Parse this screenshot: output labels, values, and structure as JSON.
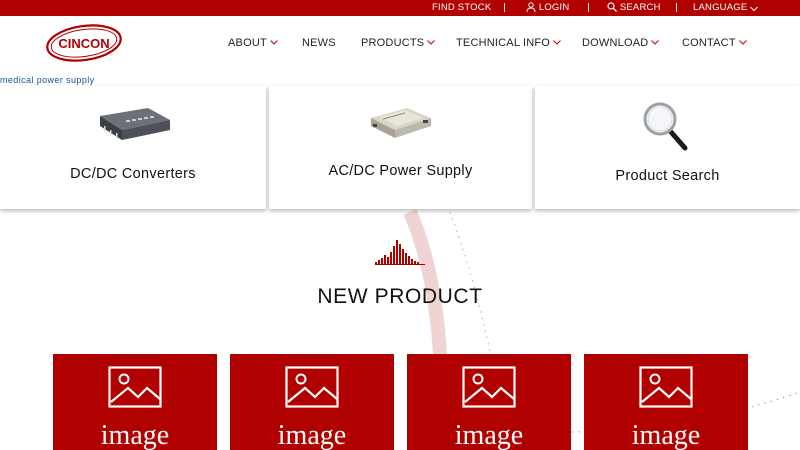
{
  "topbar": {
    "find_stock": "FIND STOCK",
    "login": "LOGIN",
    "search": "SEARCH",
    "language": "LANGUAGE"
  },
  "brand": {
    "logo_text": "CINCON",
    "tagline": "medical power supply"
  },
  "nav": {
    "about": "ABOUT",
    "news": "NEWS",
    "products": "PRODUCTS",
    "technical_info": "TECHNICAL INFO",
    "download": "DOWNLOAD",
    "contact": "CONTACT"
  },
  "categories": [
    {
      "label": "DC/DC Converters",
      "icon": "dc-dc-converter-image"
    },
    {
      "label": "AC/DC Power Supply",
      "icon": "ac-dc-power-supply-image"
    },
    {
      "label": "Product Search",
      "icon": "magnifier-icon"
    }
  ],
  "new_product": {
    "title": "NEW PRODUCT",
    "items": [
      {
        "placeholder": "image"
      },
      {
        "placeholder": "image"
      },
      {
        "placeholder": "image"
      },
      {
        "placeholder": "image"
      }
    ]
  },
  "colors": {
    "brand_red": "#b00000",
    "tagline_blue": "#1f4e9a",
    "arc_pink": "#f2d3d3"
  }
}
